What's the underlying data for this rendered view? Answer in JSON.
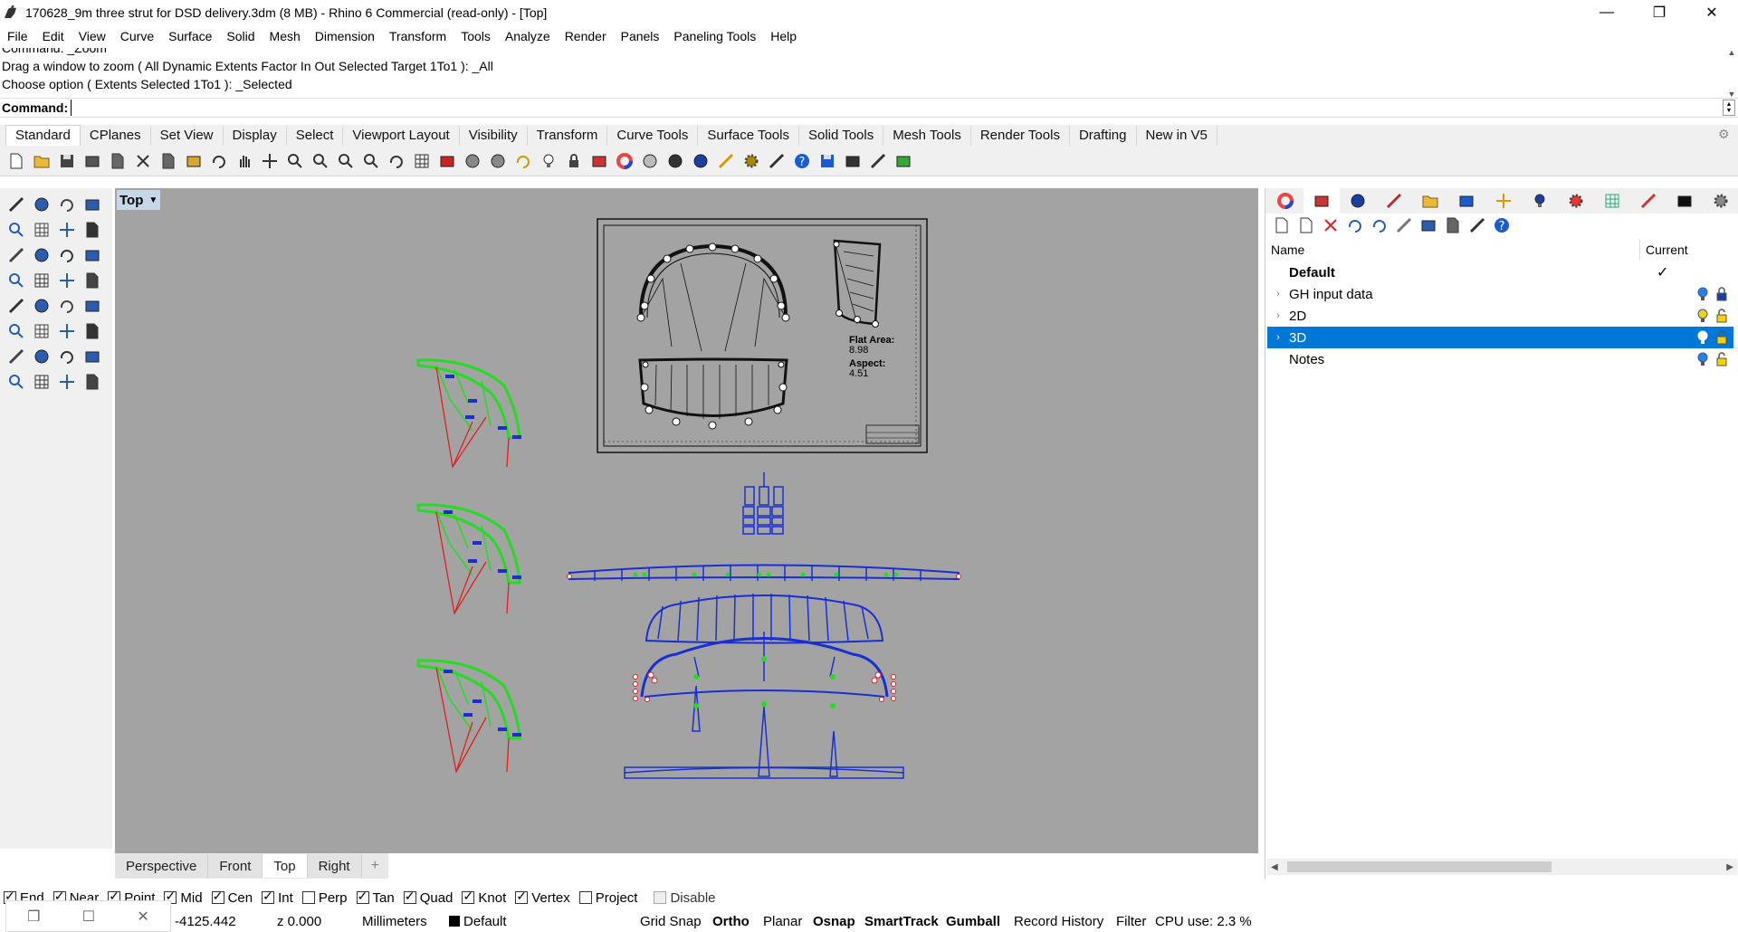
{
  "window": {
    "title": "170628_9m three strut for DSD delivery.3dm (8 MB) - Rhino 6 Commercial (read-only) - [Top]",
    "controls": [
      "—",
      "❐",
      "✕"
    ]
  },
  "menu": [
    "File",
    "Edit",
    "View",
    "Curve",
    "Surface",
    "Solid",
    "Mesh",
    "Dimension",
    "Transform",
    "Tools",
    "Analyze",
    "Render",
    "Panels",
    "Paneling Tools",
    "Help"
  ],
  "command_history": [
    "Command: _Zoom",
    "Drag a window to zoom ( All  Dynamic  Extents  Factor  In  Out  Selected  Target  1To1 ): _All",
    "Choose option ( Extents  Selected  1To1 ): _Selected"
  ],
  "command_prompt": {
    "label": "Command:",
    "value": ""
  },
  "toolbar_tabs": [
    "Standard",
    "CPlanes",
    "Set View",
    "Display",
    "Select",
    "Viewport Layout",
    "Visibility",
    "Transform",
    "Curve Tools",
    "Surface Tools",
    "Solid Tools",
    "Mesh Tools",
    "Render Tools",
    "Drafting",
    "New in V5"
  ],
  "active_toolbar_tab": "Standard",
  "viewport": {
    "name": "Top",
    "drawing_text": {
      "flat_area_label": "Flat Area:",
      "flat_area_value": "8.98",
      "aspect_label": "Aspect:",
      "aspect_value": "4.51"
    }
  },
  "viewport_tabs": [
    "Perspective",
    "Front",
    "Top",
    "Right"
  ],
  "active_viewport_tab": "Top",
  "layers": {
    "columns": {
      "name": "Name",
      "current": "Current"
    },
    "rows": [
      {
        "name": "Default",
        "expandable": false,
        "current": true,
        "bold": true,
        "selected": false
      },
      {
        "name": "GH input data",
        "expandable": true,
        "current": false,
        "bold": false,
        "selected": false,
        "bulb": "on-blue",
        "lock": "locked"
      },
      {
        "name": "2D",
        "expandable": true,
        "current": false,
        "bold": false,
        "selected": false,
        "bulb": "on-yellow",
        "lock": "unlocked"
      },
      {
        "name": "3D",
        "expandable": true,
        "current": false,
        "bold": false,
        "selected": true,
        "bulb": "on",
        "lock": "unlocked"
      },
      {
        "name": "Notes",
        "expandable": false,
        "current": false,
        "bold": false,
        "selected": false,
        "bulb": "on-blue",
        "lock": "unlocked"
      }
    ]
  },
  "osnaps": [
    {
      "label": "End",
      "checked": true
    },
    {
      "label": "Near",
      "checked": true
    },
    {
      "label": "Point",
      "checked": true
    },
    {
      "label": "Mid",
      "checked": true
    },
    {
      "label": "Cen",
      "checked": true
    },
    {
      "label": "Int",
      "checked": true
    },
    {
      "label": "Perp",
      "checked": false
    },
    {
      "label": "Tan",
      "checked": true
    },
    {
      "label": "Quad",
      "checked": true
    },
    {
      "label": "Knot",
      "checked": true
    },
    {
      "label": "Vertex",
      "checked": true
    },
    {
      "label": "Project",
      "checked": false
    },
    {
      "label": "Disable",
      "checked": false,
      "disabled": true
    }
  ],
  "status": {
    "x": "-4125.442",
    "z": "z 0.000",
    "units": "Millimeters",
    "layer": "Default",
    "grid_snap": "Grid Snap",
    "ortho": "Ortho",
    "planar": "Planar",
    "osnap": "Osnap",
    "smarttrack": "SmartTrack",
    "gumball": "Gumball",
    "record_history": "Record History",
    "filter": "Filter",
    "cpu": "CPU use: 2.3 %"
  },
  "colors": {
    "viewport_bg": "#a3a3a3",
    "selection": "#0078d7",
    "curve_blue": "#1a2fd0",
    "curve_green": "#22dd22",
    "curve_red": "#e02020"
  }
}
